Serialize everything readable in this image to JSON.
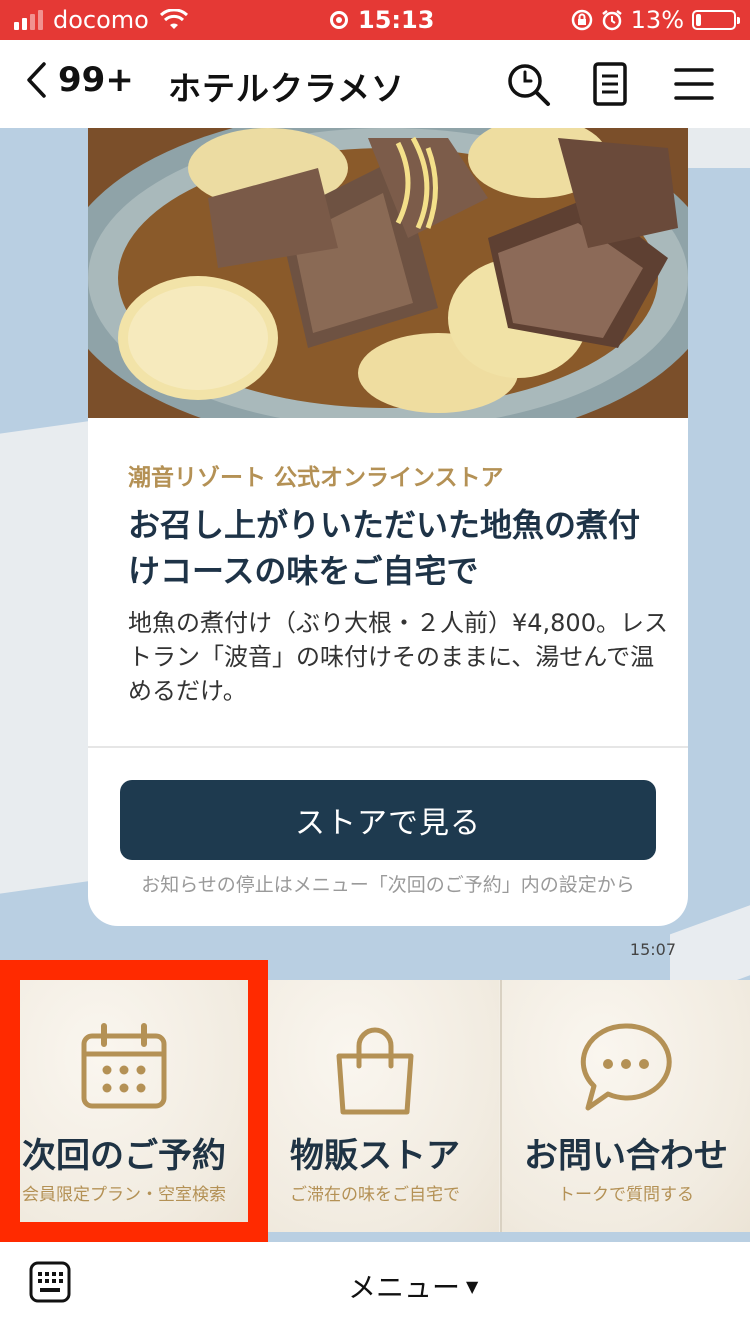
{
  "status_bar": {
    "carrier": "docomo",
    "time": "15:13",
    "battery": "13%"
  },
  "nav": {
    "back_count": "99+",
    "title": "ホテルクラメソ",
    "icons": [
      "search-icon",
      "notes-icon",
      "menu-icon"
    ]
  },
  "message": {
    "brand": "潮音リゾート 公式オンラインストア",
    "headline": "お召し上がりいただいた地魚の煮付けコースの味をご自宅で",
    "description": "地魚の煮付け（ぶり大根・２人前）¥4,800。レストラン「波音」の味付けそのままに、湯せんで温めるだけ。",
    "button_label": "ストアで見る",
    "footnote": "お知らせの停止はメニュー「次回のご予約」内の設定から",
    "time": "15:07"
  },
  "rich_menu": {
    "items": [
      {
        "title": "次回のご予約",
        "subtitle": "会員限定プラン・空室検索",
        "icon": "calendar-icon"
      },
      {
        "title": "物販ストア",
        "subtitle": "ご滞在の味をご自宅で",
        "icon": "shopping-bag-icon"
      },
      {
        "title": "お問い合わせ",
        "subtitle": "トークで質問する",
        "icon": "chat-bubble-icon"
      }
    ],
    "accent_color": "#b49155",
    "title_color": "#1f3344",
    "highlight_color": "#ff2a00"
  },
  "bottom_bar": {
    "menu_label": "メニュー",
    "caret": "▼"
  }
}
